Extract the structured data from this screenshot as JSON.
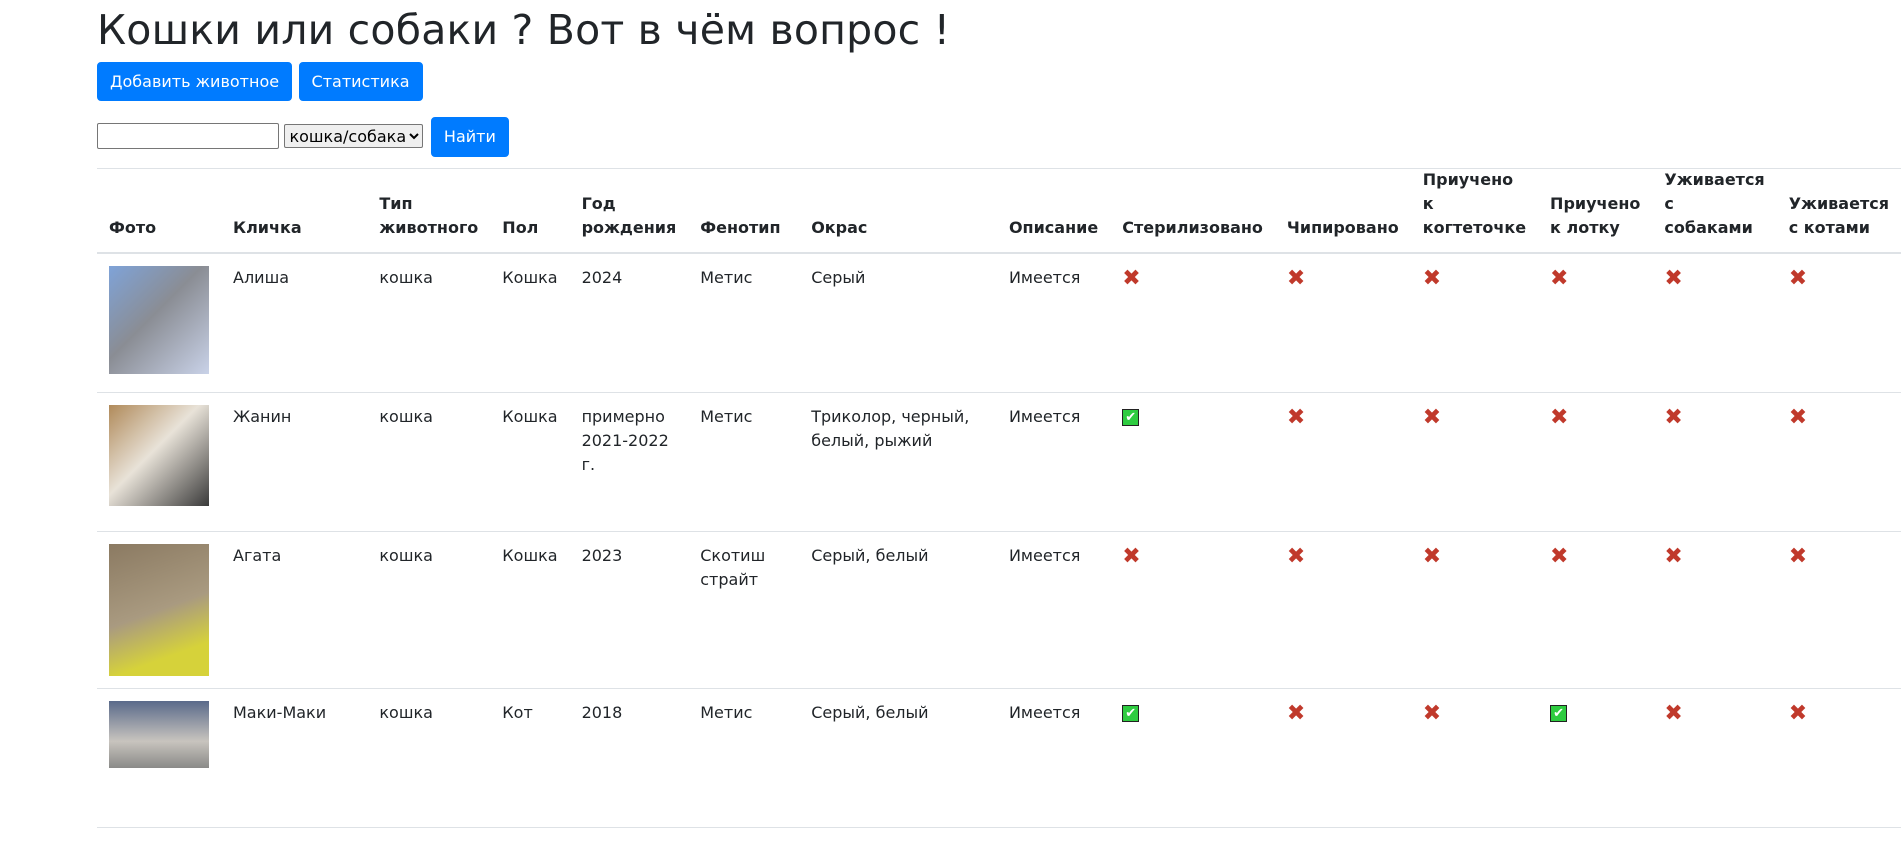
{
  "page": {
    "title": "Кошки или собаки ? Вот в чём вопрос !"
  },
  "toolbar": {
    "add_label": "Добавить животное",
    "stats_label": "Статистика"
  },
  "search": {
    "value": "",
    "type_selected": "кошка/собака",
    "button_label": "Найти"
  },
  "table": {
    "headers": [
      "Фото",
      "Кличка",
      "Тип животного",
      "Пол",
      "Год рождения",
      "Фенотип",
      "Окрас",
      "Описание",
      "Стерилизовано",
      "Чипировано",
      "Приучено к когтеточке",
      "Приучено к лотку",
      "Уживается с собаками",
      "Уживается с котами"
    ],
    "rows": [
      {
        "name": "Алиша",
        "type": "кошка",
        "sex": "Кошка",
        "year": "2024",
        "phenotype": "Метис",
        "color": "Серый",
        "desc": "Имеется",
        "sterilized": false,
        "chipped": false,
        "scratch": false,
        "litter": false,
        "dogs": false,
        "cats": false
      },
      {
        "name": "Жанин",
        "type": "кошка",
        "sex": "Кошка",
        "year": "примерно 2021-2022 г.",
        "phenotype": "Метис",
        "color": "Триколор, черный, белый, рыжий",
        "desc": "Имеется",
        "sterilized": true,
        "chipped": false,
        "scratch": false,
        "litter": false,
        "dogs": false,
        "cats": false
      },
      {
        "name": "Агата",
        "type": "кошка",
        "sex": "Кошка",
        "year": "2023",
        "phenotype": "Скотиш страйт",
        "color": "Серый, белый",
        "desc": "Имеется",
        "sterilized": false,
        "chipped": false,
        "scratch": false,
        "litter": false,
        "dogs": false,
        "cats": false
      },
      {
        "name": "Маки-Маки",
        "type": "кошка",
        "sex": "Кот",
        "year": "2018",
        "phenotype": "Метис",
        "color": "Серый, белый",
        "desc": "Имеется",
        "sterilized": true,
        "chipped": false,
        "scratch": false,
        "litter": true,
        "dogs": false,
        "cats": false
      }
    ]
  },
  "icons": {
    "yes": "check-icon",
    "no": "cross-icon"
  },
  "colors": {
    "primary": "#007bff",
    "yes": "#2ecc40",
    "no": "#c0392b"
  }
}
